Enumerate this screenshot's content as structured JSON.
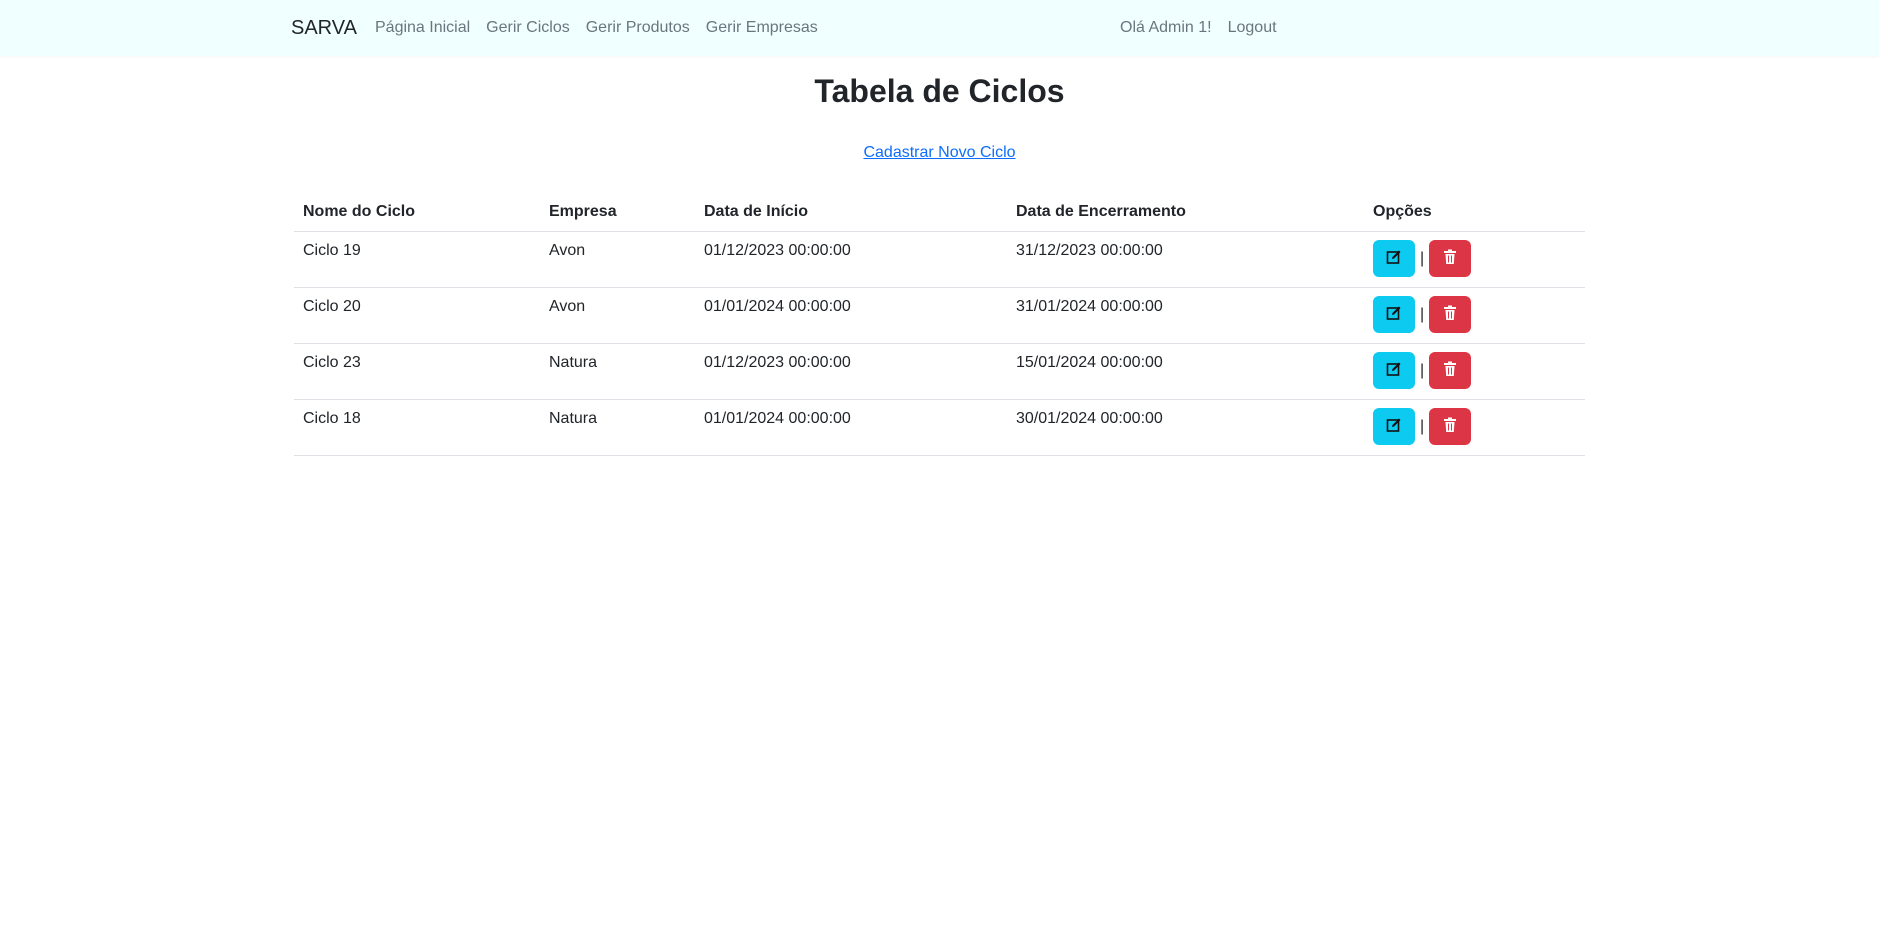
{
  "navbar": {
    "brand": "SARVA",
    "links": [
      {
        "label": "Página Inicial"
      },
      {
        "label": "Gerir Ciclos"
      },
      {
        "label": "Gerir Produtos"
      },
      {
        "label": "Gerir Empresas"
      }
    ],
    "greeting": "Olá Admin 1!",
    "logout": "Logout",
    "background_color": "#f0ffff"
  },
  "page": {
    "title": "Tabela de Ciclos",
    "create_link": "Cadastrar Novo Ciclo"
  },
  "table": {
    "headers": [
      "Nome do Ciclo",
      "Empresa",
      "Data de Início",
      "Data de Encerramento",
      "Opções"
    ],
    "rows": [
      {
        "name": "Ciclo 19",
        "company": "Avon",
        "start": "01/12/2023 00:00:00",
        "end": "31/12/2023 00:00:00"
      },
      {
        "name": "Ciclo 20",
        "company": "Avon",
        "start": "01/01/2024 00:00:00",
        "end": "31/01/2024 00:00:00"
      },
      {
        "name": "Ciclo 23",
        "company": "Natura",
        "start": "01/12/2023 00:00:00",
        "end": "15/01/2024 00:00:00"
      },
      {
        "name": "Ciclo 18",
        "company": "Natura",
        "start": "01/01/2024 00:00:00",
        "end": "30/01/2024 00:00:00"
      }
    ],
    "separator": "|",
    "edit_icon": "edit-square-icon",
    "delete_icon": "trash-icon",
    "edit_color": "#0dcaf0",
    "delete_color": "#dc3545"
  }
}
